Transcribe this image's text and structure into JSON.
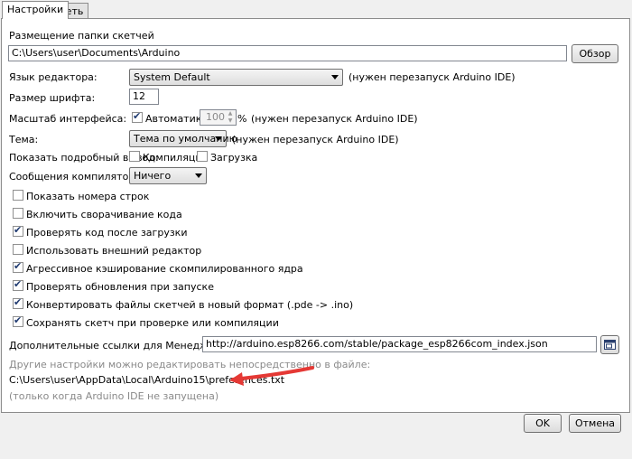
{
  "tabs": [
    {
      "label": "Настройки"
    },
    {
      "label": "Сеть"
    }
  ],
  "sketchbook": {
    "label": "Размещение папки скетчей",
    "path": "C:\\Users\\user\\Documents\\Arduino",
    "browse_label": "Обзор"
  },
  "language": {
    "label": "Язык редактора:",
    "value": "System Default",
    "note": "(нужен перезапуск Arduino IDE)"
  },
  "font_size": {
    "label": "Размер шрифта:",
    "value": "12"
  },
  "scale": {
    "label": "Масштаб интерфейса:",
    "auto_label": "Автоматика",
    "auto_checked": true,
    "value": "100",
    "unit": "%",
    "note": "(нужен перезапуск Arduino IDE)"
  },
  "theme": {
    "label": "Тема:",
    "value": "Тема по умолчанию",
    "note": "(нужен перезапуск Arduino IDE)"
  },
  "verbose": {
    "label": "Показать подробный вывод:",
    "compile_label": "Компиляция",
    "upload_label": "Загрузка"
  },
  "warnings": {
    "label": "Сообщения компилятора:",
    "value": "Ничего"
  },
  "options": [
    {
      "label": "Показать номера строк",
      "checked": false
    },
    {
      "label": "Включить сворачивание кода",
      "checked": false
    },
    {
      "label": "Проверять код после загрузки",
      "checked": true
    },
    {
      "label": "Использовать внешний редактор",
      "checked": false
    },
    {
      "label": "Агрессивное кэширование скомпилированного ядра",
      "checked": true
    },
    {
      "label": "Проверять обновления при запуске",
      "checked": true
    },
    {
      "label": "Конвертировать файлы скетчей в новый формат (.pde -> .ino)",
      "checked": true
    },
    {
      "label": "Сохранять скетч при проверке или компиляции",
      "checked": true
    }
  ],
  "boards_manager": {
    "label": "Дополнительные ссылки для Менеджера плат:",
    "url": "http://arduino.esp8266.com/stable/package_esp8266com_index.json"
  },
  "prefs_note": "Другие настройки можно редактировать непосредственно в файле:",
  "prefs_path": "C:\\Users\\user\\AppData\\Local\\Arduino15\\preferences.txt",
  "prefs_hint": "(только когда Arduino IDE не запущена)",
  "buttons": {
    "ok": "OK",
    "cancel": "Отмена"
  },
  "colors": {
    "arrow": "#e53935"
  }
}
